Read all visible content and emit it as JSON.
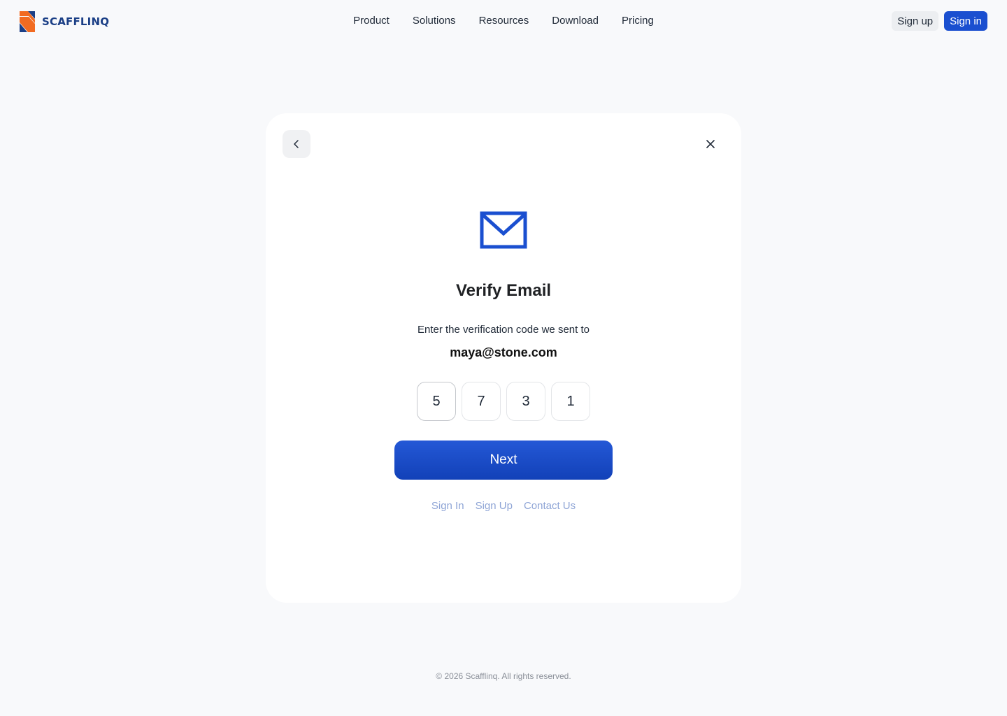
{
  "brand": {
    "name": "SCAFFLINQ",
    "colors": {
      "primary": "#1a4fd0",
      "logo_orange": "#f26b21",
      "logo_navy": "#1b3f86"
    }
  },
  "nav": {
    "items": [
      {
        "label": "Product"
      },
      {
        "label": "Solutions"
      },
      {
        "label": "Resources"
      },
      {
        "label": "Download"
      },
      {
        "label": "Pricing"
      }
    ]
  },
  "auth": {
    "signup_label": "Sign up",
    "signin_label": "Sign in"
  },
  "dialog": {
    "back_icon": "chevron-left-icon",
    "close_icon": "close-icon",
    "hero_icon": "mail-icon",
    "title": "Verify Email",
    "subtitle": "Enter the verification code we sent to",
    "email": "maya@stone.com",
    "code": [
      "5",
      "7",
      "3",
      "1"
    ],
    "next_label": "Next",
    "links": [
      {
        "label": "Sign In"
      },
      {
        "label": "Sign Up"
      },
      {
        "label": "Contact Us"
      }
    ]
  },
  "footer": {
    "copyright": "© 2026 Scafflinq. All rights reserved."
  }
}
